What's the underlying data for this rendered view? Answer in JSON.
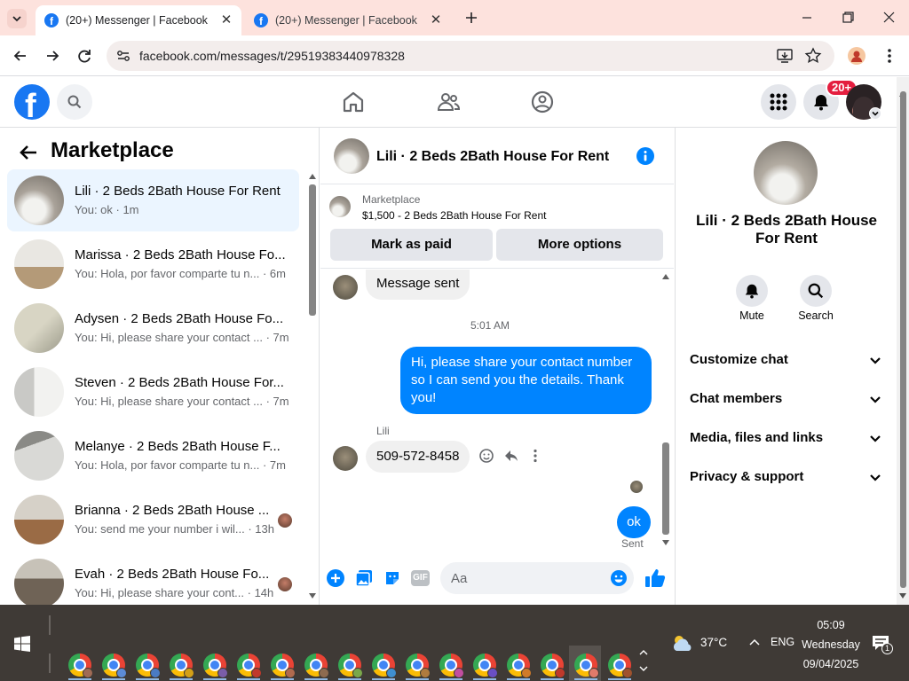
{
  "browser": {
    "tabs": [
      {
        "title": "(20+) Messenger | Facebook"
      },
      {
        "title": "(20+) Messenger | Facebook"
      }
    ],
    "url": "facebook.com/messages/t/29519383440978328"
  },
  "header": {
    "notifications_badge": "20+"
  },
  "sidebar": {
    "title": "Marketplace",
    "conversations": [
      {
        "name": "Lili · 2 Beds 2Bath House For Rent",
        "preview": "You: ok · 1m",
        "selected": true
      },
      {
        "name": "Marissa · 2 Beds 2Bath House Fo...",
        "preview": "You: Hola, por favor comparte tu n... · 6m"
      },
      {
        "name": "Adysen · 2 Beds 2Bath House Fo...",
        "preview": "You: Hi, please share your contact ... · 7m"
      },
      {
        "name": "Steven · 2 Beds 2Bath House For...",
        "preview": "You: Hi, please share your contact ... · 7m"
      },
      {
        "name": "Melanye · 2 Beds 2Bath House F...",
        "preview": "You: Hola, por favor comparte tu n... · 7m"
      },
      {
        "name": "Brianna · 2 Beds 2Bath House ...",
        "preview": "You: send me your number i wil... · 13h"
      },
      {
        "name": "Evah · 2 Beds 2Bath House Fo...",
        "preview": "You: Hi, please share your cont... · 14h"
      }
    ]
  },
  "chat": {
    "title": "Lili · 2 Beds 2Bath House For Rent",
    "listing_label": "Marketplace",
    "listing_text": "$1,500 - 2 Beds 2Bath House For Rent",
    "mark_paid": "Mark as paid",
    "more_options": "More options",
    "msg_sent_bubble": "Message sent",
    "timestamp": "5:01 AM",
    "outgoing_msg": "Hi, please share your contact number so I can send you the details. Thank you!",
    "sender_name": "Lili",
    "incoming_msg": "509-572-8458",
    "ok_msg": "ok",
    "sent_status": "Sent",
    "composer_placeholder": "Aa"
  },
  "details": {
    "title": "Lili · 2 Beds 2Bath House For Rent",
    "mute_label": "Mute",
    "search_label": "Search",
    "sections": [
      "Customize chat",
      "Chat members",
      "Media, files and links",
      "Privacy & support"
    ]
  },
  "taskbar": {
    "weather": "37°C",
    "lang": "ENG",
    "time": "05:09",
    "day": "Wednesday",
    "date": "09/04/2025",
    "notif_count": "1"
  },
  "colors": {
    "accent": "#0084ff",
    "fb_blue": "#1877f2",
    "badge": "#e41e3f"
  }
}
